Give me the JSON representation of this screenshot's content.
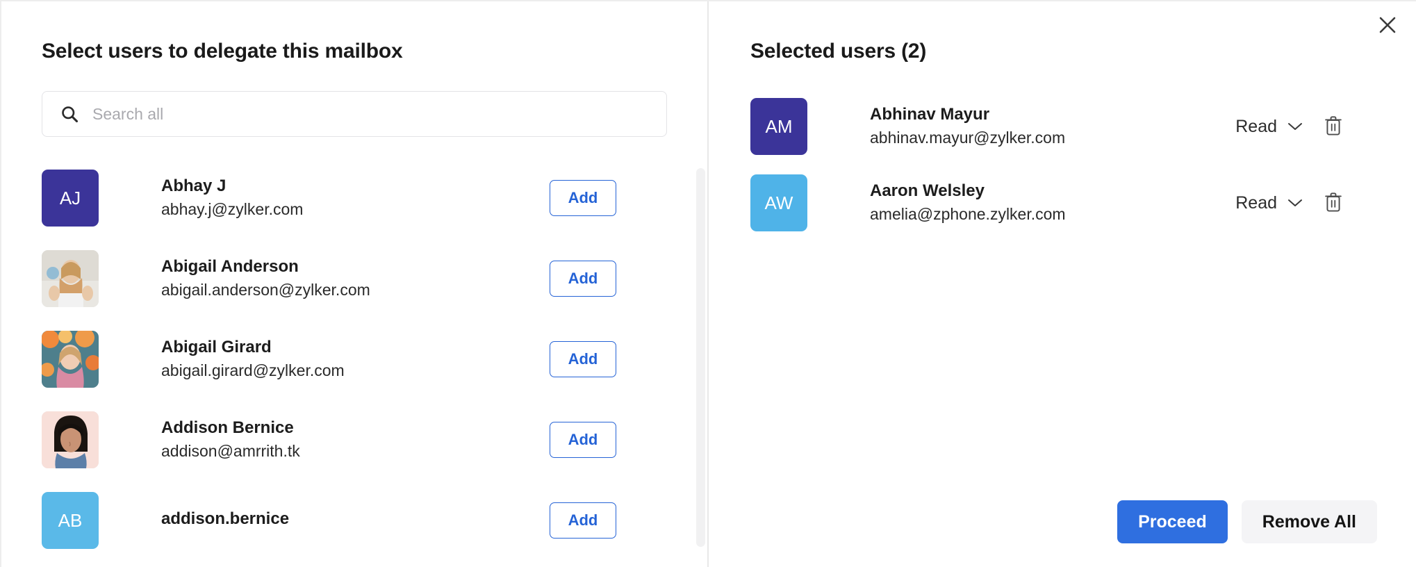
{
  "dialog": {
    "close_label": "close-icon"
  },
  "left": {
    "title": "Select users to delegate this mailbox",
    "search": {
      "placeholder": "Search all",
      "value": "",
      "icon": "search-icon"
    },
    "add_label": "Add",
    "users": [
      {
        "name": "Abhay J",
        "email": "abhay.j@zylker.com",
        "avatar_type": "initials",
        "initials": "AJ",
        "avatar_color": "#3b3499",
        "action": "Add"
      },
      {
        "name": "Abigail Anderson",
        "email": "abigail.anderson@zylker.com",
        "avatar_type": "photo",
        "initials": "",
        "avatar_color": "#dfe3e8",
        "action": "Add"
      },
      {
        "name": "Abigail Girard",
        "email": "abigail.girard@zylker.com",
        "avatar_type": "photo",
        "initials": "",
        "avatar_color": "#e4a46a",
        "action": "Add"
      },
      {
        "name": "Addison Bernice",
        "email": "addison@amrrith.tk",
        "avatar_type": "photo",
        "initials": "",
        "avatar_color": "#f7ddd8",
        "action": "Add"
      },
      {
        "name": "addison.bernice",
        "email": "",
        "avatar_type": "initials",
        "initials": "AB",
        "avatar_color": "#5ab9e8",
        "action": "Add"
      }
    ]
  },
  "right": {
    "title": "Selected users (2)",
    "selected": [
      {
        "name": "Abhinav Mayur",
        "email": "abhinav.mayur@zylker.com",
        "initials": "AM",
        "avatar_color": "#3b3499",
        "permission": "Read",
        "delete_icon": "trash-icon"
      },
      {
        "name": "Aaron Welsley",
        "email": "amelia@zphone.zylker.com",
        "initials": "AW",
        "avatar_color": "#4fb3e8",
        "permission": "Read",
        "delete_icon": "trash-icon"
      }
    ],
    "footer": {
      "proceed_label": "Proceed",
      "remove_all_label": "Remove All"
    }
  },
  "colors": {
    "accent_blue": "#2f6fe0",
    "add_btn_blue": "#2563d6",
    "divider": "#e8e8e8",
    "text_primary": "#1a1a1a",
    "placeholder": "#a9a9ae"
  }
}
